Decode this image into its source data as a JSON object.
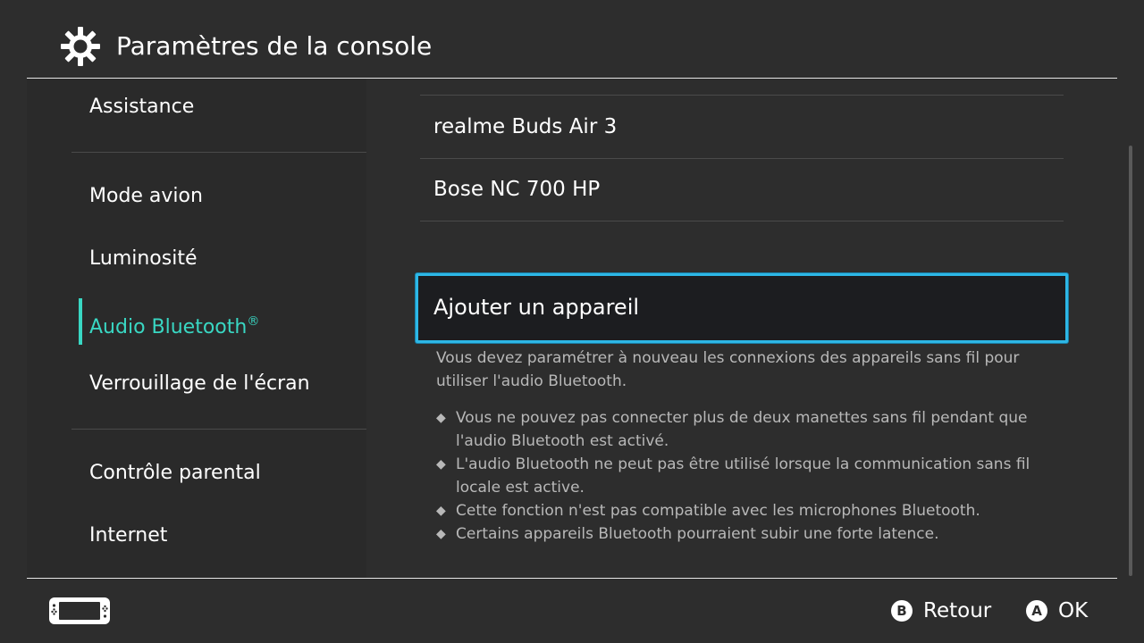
{
  "header": {
    "title": "Paramètres de la console",
    "icon": "gear-icon"
  },
  "sidebar": {
    "items": [
      {
        "label": "Assistance",
        "active": false
      },
      {
        "label": "Mode avion",
        "active": false
      },
      {
        "label": "Luminosité",
        "active": false
      },
      {
        "label": "Audio Bluetooth",
        "label_suffix": "®",
        "active": true
      },
      {
        "label": "Verrouillage de l'écran",
        "active": false
      },
      {
        "label": "Contrôle parental",
        "active": false
      },
      {
        "label": "Internet",
        "active": false
      }
    ]
  },
  "main": {
    "devices": [
      {
        "label": "realme Buds Air 3"
      },
      {
        "label": "Bose NC 700 HP"
      }
    ],
    "add_device_label": "Ajouter un appareil",
    "description": "Vous devez paramétrer à nouveau les connexions des appareils sans fil pour utiliser l'audio Bluetooth.",
    "notes": [
      "Vous ne pouvez pas connecter plus de deux manettes sans fil pendant que l'audio Bluetooth est activé.",
      "L'audio Bluetooth ne peut pas être utilisé lorsque la communication sans fil locale est active.",
      "Cette fonction n'est pas compatible avec les microphones Bluetooth.",
      "Certains appareils Bluetooth pourraient subir une forte latence."
    ],
    "bullet_glyph": "◆"
  },
  "footer": {
    "console_icon": "console-icon",
    "back": {
      "button": "B",
      "label": "Retour"
    },
    "ok": {
      "button": "A",
      "label": "OK"
    }
  },
  "colors": {
    "background": "#2d2d2d",
    "accent": "#39d7c3",
    "focus_border": "#2db7e6"
  }
}
